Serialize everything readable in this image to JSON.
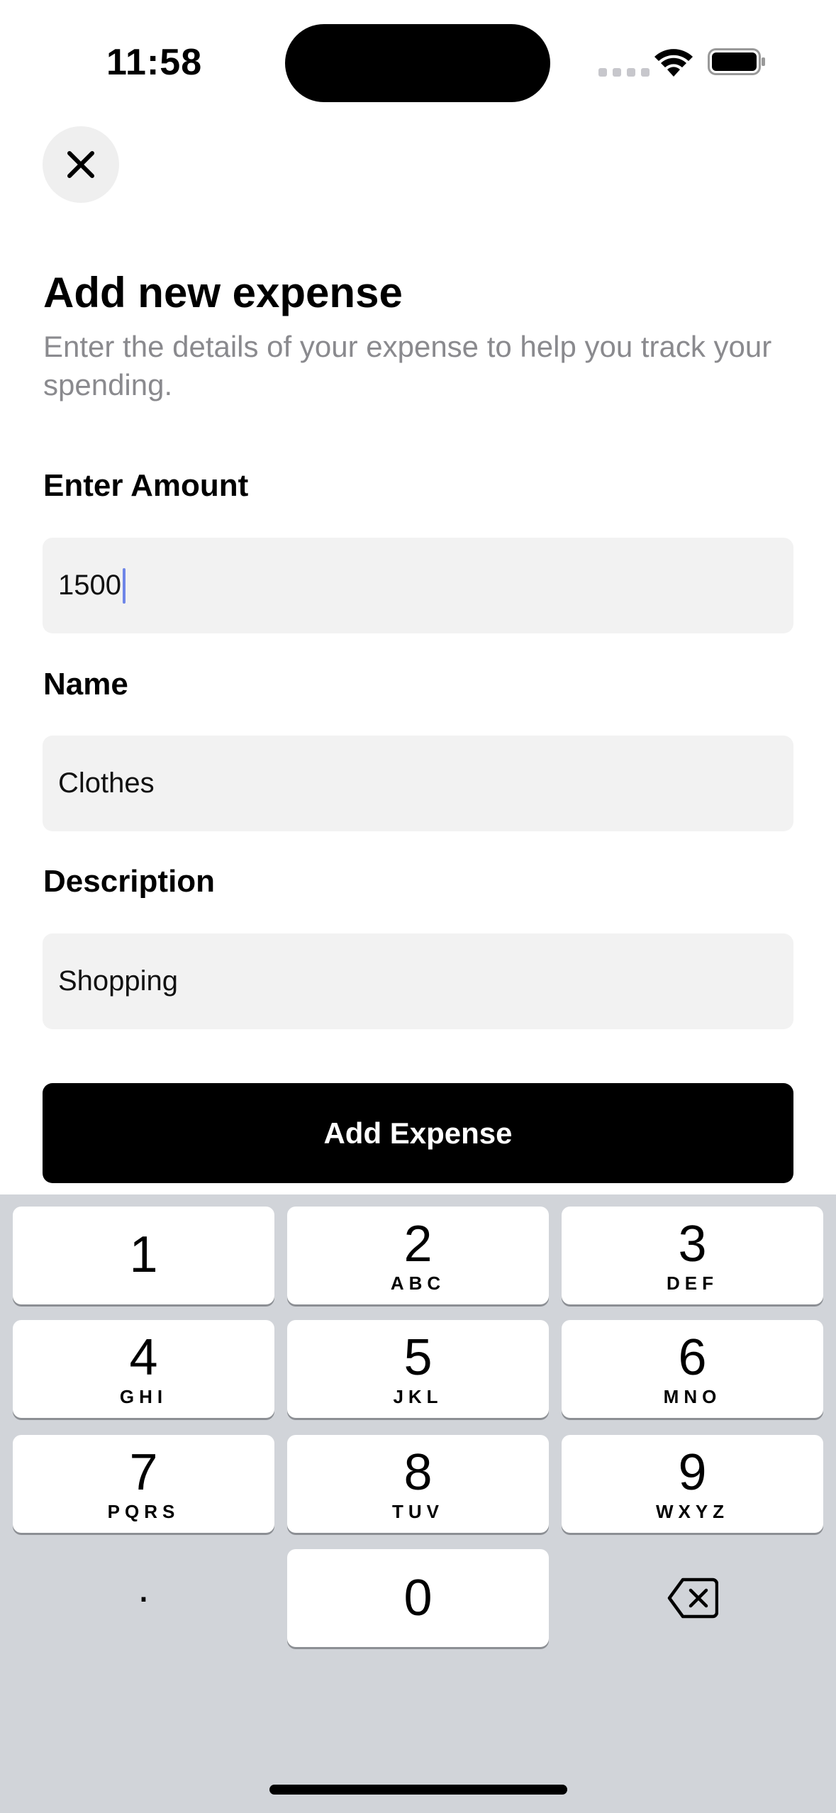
{
  "status_bar": {
    "time": "11:58"
  },
  "form": {
    "title": "Add new expense",
    "subtitle": "Enter the details of your expense to help you track your spending.",
    "amount_label": "Enter Amount",
    "amount_value": "1500",
    "name_label": "Name",
    "name_value": "Clothes",
    "description_label": "Description",
    "description_value": "Shopping",
    "submit_label": "Add Expense"
  },
  "keypad": {
    "keys": [
      {
        "num": "1",
        "letters": ""
      },
      {
        "num": "2",
        "letters": "ABC"
      },
      {
        "num": "3",
        "letters": "DEF"
      },
      {
        "num": "4",
        "letters": "GHI"
      },
      {
        "num": "5",
        "letters": "JKL"
      },
      {
        "num": "6",
        "letters": "MNO"
      },
      {
        "num": "7",
        "letters": "PQRS"
      },
      {
        "num": "8",
        "letters": "TUV"
      },
      {
        "num": "9",
        "letters": "WXYZ"
      }
    ],
    "dot": ".",
    "zero": "0"
  }
}
